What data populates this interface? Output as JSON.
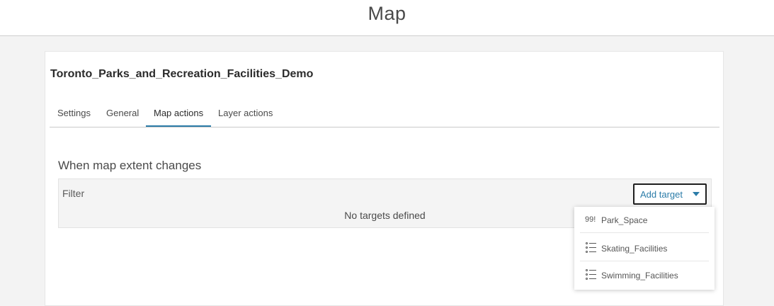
{
  "header": {
    "title": "Map"
  },
  "app": {
    "title": "Toronto_Parks_and_Recreation_Facilities_Demo"
  },
  "tabs": [
    {
      "label": "Settings",
      "active": false
    },
    {
      "label": "General",
      "active": false
    },
    {
      "label": "Map actions",
      "active": true
    },
    {
      "label": "Layer actions",
      "active": false
    }
  ],
  "section": {
    "title": "When map extent changes",
    "filter_label": "Filter",
    "empty_message": "No targets defined"
  },
  "add_target": {
    "label": "Add target",
    "icon": "caret-down-icon"
  },
  "dropdown": {
    "items": [
      {
        "label": "Park_Space",
        "icon": "point-layer-icon",
        "icon_glyph": "99!"
      },
      {
        "label": "Skating_Facilities",
        "icon": "list-layer-icon"
      },
      {
        "label": "Swimming_Facilities",
        "icon": "list-layer-icon"
      }
    ]
  },
  "colors": {
    "accent": "#2b7ca8",
    "background": "#f3f3f3"
  }
}
